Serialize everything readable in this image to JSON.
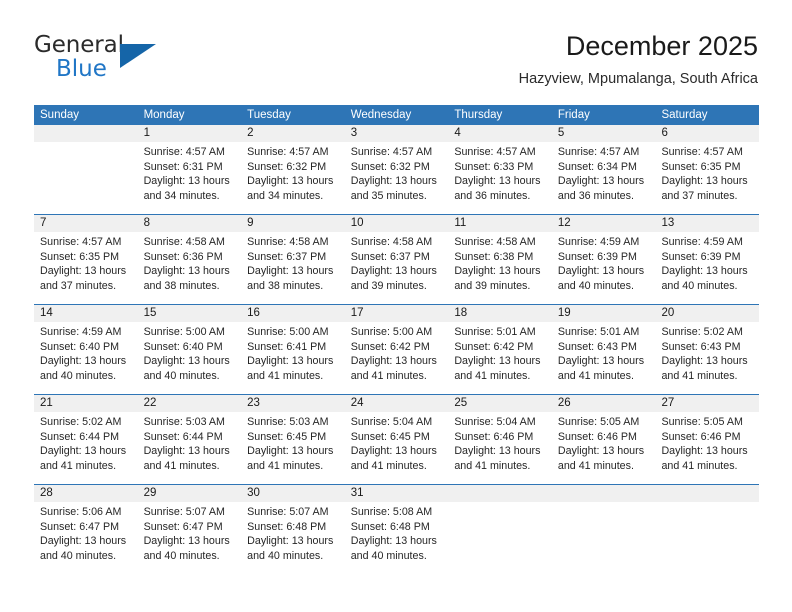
{
  "brand": {
    "name_top": "General",
    "name_bottom": "Blue",
    "triangle_color": "#1565a8",
    "blue_color": "#2076c6"
  },
  "header": {
    "title": "December 2025",
    "subtitle": "Hazyview, Mpumalanga, South Africa"
  },
  "theme": {
    "header_bg": "#2e75b6",
    "daynum_bg": "#f0f0f0",
    "row_border": "#2e75b6",
    "text": "#262626"
  },
  "weekdays": [
    "Sunday",
    "Monday",
    "Tuesday",
    "Wednesday",
    "Thursday",
    "Friday",
    "Saturday"
  ],
  "weeks": [
    [
      {
        "day": "",
        "sunrise": "",
        "sunset": "",
        "daylight1": "",
        "daylight2": ""
      },
      {
        "day": "1",
        "sunrise": "Sunrise: 4:57 AM",
        "sunset": "Sunset: 6:31 PM",
        "daylight1": "Daylight: 13 hours",
        "daylight2": "and 34 minutes."
      },
      {
        "day": "2",
        "sunrise": "Sunrise: 4:57 AM",
        "sunset": "Sunset: 6:32 PM",
        "daylight1": "Daylight: 13 hours",
        "daylight2": "and 34 minutes."
      },
      {
        "day": "3",
        "sunrise": "Sunrise: 4:57 AM",
        "sunset": "Sunset: 6:32 PM",
        "daylight1": "Daylight: 13 hours",
        "daylight2": "and 35 minutes."
      },
      {
        "day": "4",
        "sunrise": "Sunrise: 4:57 AM",
        "sunset": "Sunset: 6:33 PM",
        "daylight1": "Daylight: 13 hours",
        "daylight2": "and 36 minutes."
      },
      {
        "day": "5",
        "sunrise": "Sunrise: 4:57 AM",
        "sunset": "Sunset: 6:34 PM",
        "daylight1": "Daylight: 13 hours",
        "daylight2": "and 36 minutes."
      },
      {
        "day": "6",
        "sunrise": "Sunrise: 4:57 AM",
        "sunset": "Sunset: 6:35 PM",
        "daylight1": "Daylight: 13 hours",
        "daylight2": "and 37 minutes."
      }
    ],
    [
      {
        "day": "7",
        "sunrise": "Sunrise: 4:57 AM",
        "sunset": "Sunset: 6:35 PM",
        "daylight1": "Daylight: 13 hours",
        "daylight2": "and 37 minutes."
      },
      {
        "day": "8",
        "sunrise": "Sunrise: 4:58 AM",
        "sunset": "Sunset: 6:36 PM",
        "daylight1": "Daylight: 13 hours",
        "daylight2": "and 38 minutes."
      },
      {
        "day": "9",
        "sunrise": "Sunrise: 4:58 AM",
        "sunset": "Sunset: 6:37 PM",
        "daylight1": "Daylight: 13 hours",
        "daylight2": "and 38 minutes."
      },
      {
        "day": "10",
        "sunrise": "Sunrise: 4:58 AM",
        "sunset": "Sunset: 6:37 PM",
        "daylight1": "Daylight: 13 hours",
        "daylight2": "and 39 minutes."
      },
      {
        "day": "11",
        "sunrise": "Sunrise: 4:58 AM",
        "sunset": "Sunset: 6:38 PM",
        "daylight1": "Daylight: 13 hours",
        "daylight2": "and 39 minutes."
      },
      {
        "day": "12",
        "sunrise": "Sunrise: 4:59 AM",
        "sunset": "Sunset: 6:39 PM",
        "daylight1": "Daylight: 13 hours",
        "daylight2": "and 40 minutes."
      },
      {
        "day": "13",
        "sunrise": "Sunrise: 4:59 AM",
        "sunset": "Sunset: 6:39 PM",
        "daylight1": "Daylight: 13 hours",
        "daylight2": "and 40 minutes."
      }
    ],
    [
      {
        "day": "14",
        "sunrise": "Sunrise: 4:59 AM",
        "sunset": "Sunset: 6:40 PM",
        "daylight1": "Daylight: 13 hours",
        "daylight2": "and 40 minutes."
      },
      {
        "day": "15",
        "sunrise": "Sunrise: 5:00 AM",
        "sunset": "Sunset: 6:40 PM",
        "daylight1": "Daylight: 13 hours",
        "daylight2": "and 40 minutes."
      },
      {
        "day": "16",
        "sunrise": "Sunrise: 5:00 AM",
        "sunset": "Sunset: 6:41 PM",
        "daylight1": "Daylight: 13 hours",
        "daylight2": "and 41 minutes."
      },
      {
        "day": "17",
        "sunrise": "Sunrise: 5:00 AM",
        "sunset": "Sunset: 6:42 PM",
        "daylight1": "Daylight: 13 hours",
        "daylight2": "and 41 minutes."
      },
      {
        "day": "18",
        "sunrise": "Sunrise: 5:01 AM",
        "sunset": "Sunset: 6:42 PM",
        "daylight1": "Daylight: 13 hours",
        "daylight2": "and 41 minutes."
      },
      {
        "day": "19",
        "sunrise": "Sunrise: 5:01 AM",
        "sunset": "Sunset: 6:43 PM",
        "daylight1": "Daylight: 13 hours",
        "daylight2": "and 41 minutes."
      },
      {
        "day": "20",
        "sunrise": "Sunrise: 5:02 AM",
        "sunset": "Sunset: 6:43 PM",
        "daylight1": "Daylight: 13 hours",
        "daylight2": "and 41 minutes."
      }
    ],
    [
      {
        "day": "21",
        "sunrise": "Sunrise: 5:02 AM",
        "sunset": "Sunset: 6:44 PM",
        "daylight1": "Daylight: 13 hours",
        "daylight2": "and 41 minutes."
      },
      {
        "day": "22",
        "sunrise": "Sunrise: 5:03 AM",
        "sunset": "Sunset: 6:44 PM",
        "daylight1": "Daylight: 13 hours",
        "daylight2": "and 41 minutes."
      },
      {
        "day": "23",
        "sunrise": "Sunrise: 5:03 AM",
        "sunset": "Sunset: 6:45 PM",
        "daylight1": "Daylight: 13 hours",
        "daylight2": "and 41 minutes."
      },
      {
        "day": "24",
        "sunrise": "Sunrise: 5:04 AM",
        "sunset": "Sunset: 6:45 PM",
        "daylight1": "Daylight: 13 hours",
        "daylight2": "and 41 minutes."
      },
      {
        "day": "25",
        "sunrise": "Sunrise: 5:04 AM",
        "sunset": "Sunset: 6:46 PM",
        "daylight1": "Daylight: 13 hours",
        "daylight2": "and 41 minutes."
      },
      {
        "day": "26",
        "sunrise": "Sunrise: 5:05 AM",
        "sunset": "Sunset: 6:46 PM",
        "daylight1": "Daylight: 13 hours",
        "daylight2": "and 41 minutes."
      },
      {
        "day": "27",
        "sunrise": "Sunrise: 5:05 AM",
        "sunset": "Sunset: 6:46 PM",
        "daylight1": "Daylight: 13 hours",
        "daylight2": "and 41 minutes."
      }
    ],
    [
      {
        "day": "28",
        "sunrise": "Sunrise: 5:06 AM",
        "sunset": "Sunset: 6:47 PM",
        "daylight1": "Daylight: 13 hours",
        "daylight2": "and 40 minutes."
      },
      {
        "day": "29",
        "sunrise": "Sunrise: 5:07 AM",
        "sunset": "Sunset: 6:47 PM",
        "daylight1": "Daylight: 13 hours",
        "daylight2": "and 40 minutes."
      },
      {
        "day": "30",
        "sunrise": "Sunrise: 5:07 AM",
        "sunset": "Sunset: 6:48 PM",
        "daylight1": "Daylight: 13 hours",
        "daylight2": "and 40 minutes."
      },
      {
        "day": "31",
        "sunrise": "Sunrise: 5:08 AM",
        "sunset": "Sunset: 6:48 PM",
        "daylight1": "Daylight: 13 hours",
        "daylight2": "and 40 minutes."
      },
      {
        "day": "",
        "sunrise": "",
        "sunset": "",
        "daylight1": "",
        "daylight2": ""
      },
      {
        "day": "",
        "sunrise": "",
        "sunset": "",
        "daylight1": "",
        "daylight2": ""
      },
      {
        "day": "",
        "sunrise": "",
        "sunset": "",
        "daylight1": "",
        "daylight2": ""
      }
    ]
  ]
}
